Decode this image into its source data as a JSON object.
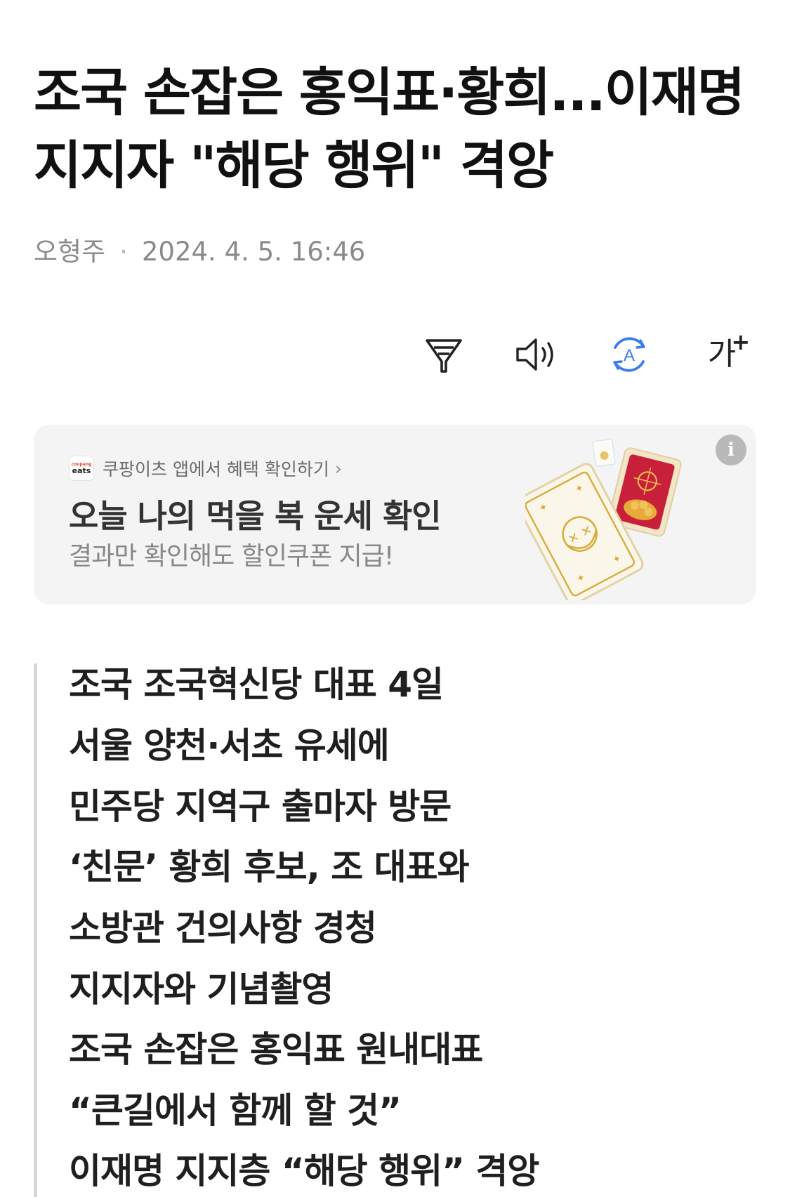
{
  "article": {
    "title_line1": "조국 손잡은 홍익표·황희...이재명",
    "title_line2": "지지자 \"해당 행위\" 격앙",
    "author": "오형주",
    "separator": "·",
    "timestamp": "2024. 4. 5. 16:46"
  },
  "toolbar": {
    "items": [
      {
        "icon": "filter-icon",
        "label": "요약"
      },
      {
        "icon": "speaker-icon",
        "label": "읽기"
      },
      {
        "icon": "translate-icon",
        "label": "번역"
      },
      {
        "icon": "font-size-icon",
        "label": "가+"
      }
    ],
    "font_size_glyph": "가",
    "font_size_plus": "+",
    "translate_glyph": "A"
  },
  "ad": {
    "logo_top": "coupang",
    "logo_bottom": "eats",
    "source": "쿠팡이츠 앱에서 혜택 확인하기",
    "source_arrow": "›",
    "headline": "오늘 나의 먹을 복 운세 확인",
    "subtext": "결과만 확인해도 할인쿠폰 지급!",
    "info_glyph": "i",
    "colors": {
      "card_gold": "#d9ab3f",
      "card_red": "#c8203a",
      "background": "#f4f4f5"
    }
  },
  "summary": {
    "lines": [
      "조국 조국혁신당 대표 4일",
      "서울 양천·서초 유세에",
      "민주당 지역구 출마자 방문",
      "‘친문’ 황희 후보, 조 대표와",
      "소방관 건의사항 경청",
      "지지자와 기념촬영",
      "조국 손잡은 홍익표 원내대표",
      "“큰길에서 함께 할 것”",
      "이재명 지지층 “해당 행위” 격앙"
    ]
  },
  "colors": {
    "accent_blue": "#3b7df0",
    "meta_gray": "#8a8a8a",
    "quote_bar": "#d7d7d7"
  }
}
